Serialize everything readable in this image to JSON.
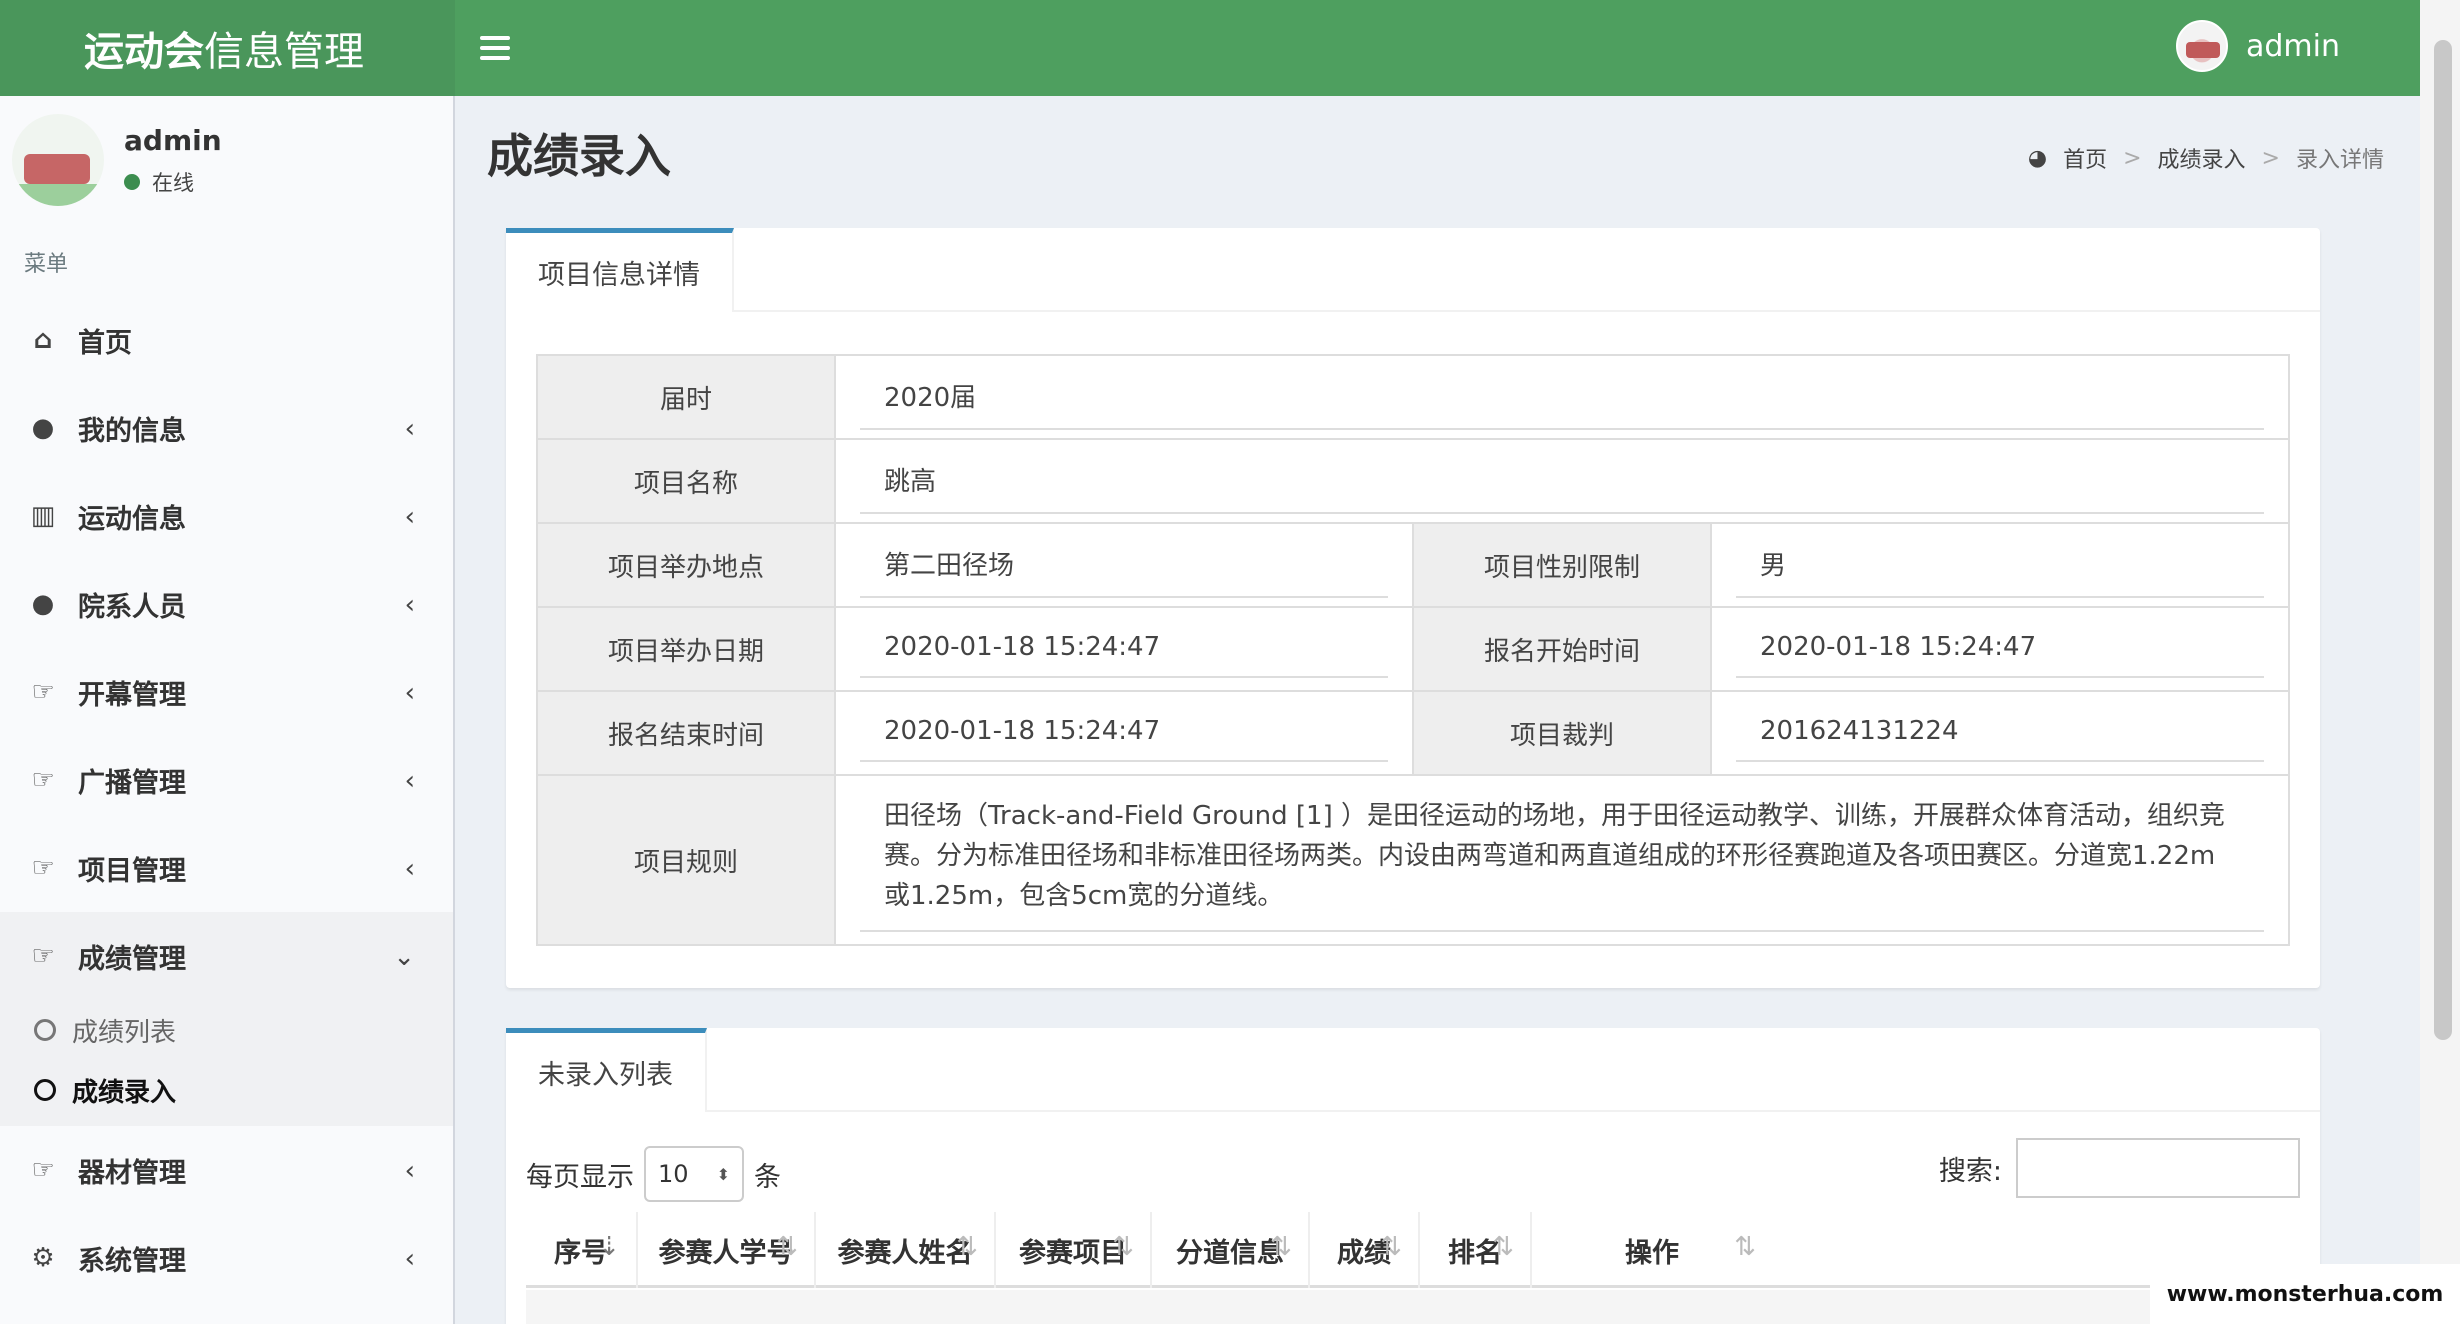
{
  "header": {
    "brand_bold": "运动会",
    "brand_rest": "信息管理",
    "user": "admin"
  },
  "sidebar": {
    "user_name": "admin",
    "user_status": "在线",
    "menu_header": "菜单",
    "items": [
      {
        "label": "首页",
        "icon": "home-icon"
      },
      {
        "label": "我的信息",
        "icon": "user-icon"
      },
      {
        "label": "运动信息",
        "icon": "bar-chart-icon"
      },
      {
        "label": "院系人员",
        "icon": "users-icon"
      },
      {
        "label": "开幕管理",
        "icon": "thumbs-up-icon"
      },
      {
        "label": "广播管理",
        "icon": "thumbs-up-icon"
      },
      {
        "label": "项目管理",
        "icon": "thumbs-up-icon"
      },
      {
        "label": "成绩管理",
        "icon": "thumbs-up-icon"
      },
      {
        "label": "器材管理",
        "icon": "thumbs-up-icon"
      },
      {
        "label": "系统管理",
        "icon": "gear-icon"
      }
    ],
    "sub_items": [
      "成绩列表",
      "成绩录入"
    ]
  },
  "page": {
    "title": "成绩录入",
    "breadcrumb": [
      "首页",
      "成绩录入",
      "录入详情"
    ]
  },
  "detail": {
    "tab": "项目信息详情",
    "session_label": "届时",
    "session": "2020届",
    "name_label": "项目名称",
    "name": "跳高",
    "place_label": "项目举办地点",
    "place": "第二田径场",
    "gender_label": "项目性别限制",
    "gender": "男",
    "date_label": "项目举办日期",
    "date": "2020-01-18 15:24:47",
    "reg_start_label": "报名开始时间",
    "reg_start": "2020-01-18 15:24:47",
    "reg_end_label": "报名结束时间",
    "reg_end": "2020-01-18 15:24:47",
    "judge_label": "项目裁判",
    "judge": "201624131224",
    "rule_label": "项目规则",
    "rule": "田径场（Track-and-Field Ground [1] ）是田径运动的场地，用于田径运动教学、训练，开展群众体育活动，组织竞赛。分为标准田径场和非标准田径场两类。内设由两弯道和两直道组成的环形径赛跑道及各项田赛区。分道宽1.22m或1.25m，包含5cm宽的分道线。"
  },
  "list": {
    "tab": "未录入列表",
    "per_page_label": "每页显示",
    "per_page_value": "10",
    "per_page_unit": "条",
    "search_label": "搜索:",
    "columns": [
      "序号",
      "参赛人学号",
      "参赛人姓名",
      "参赛项目",
      "分道信息",
      "成绩",
      "排名",
      "操作"
    ]
  },
  "watermark": "www.monsterhua.com"
}
